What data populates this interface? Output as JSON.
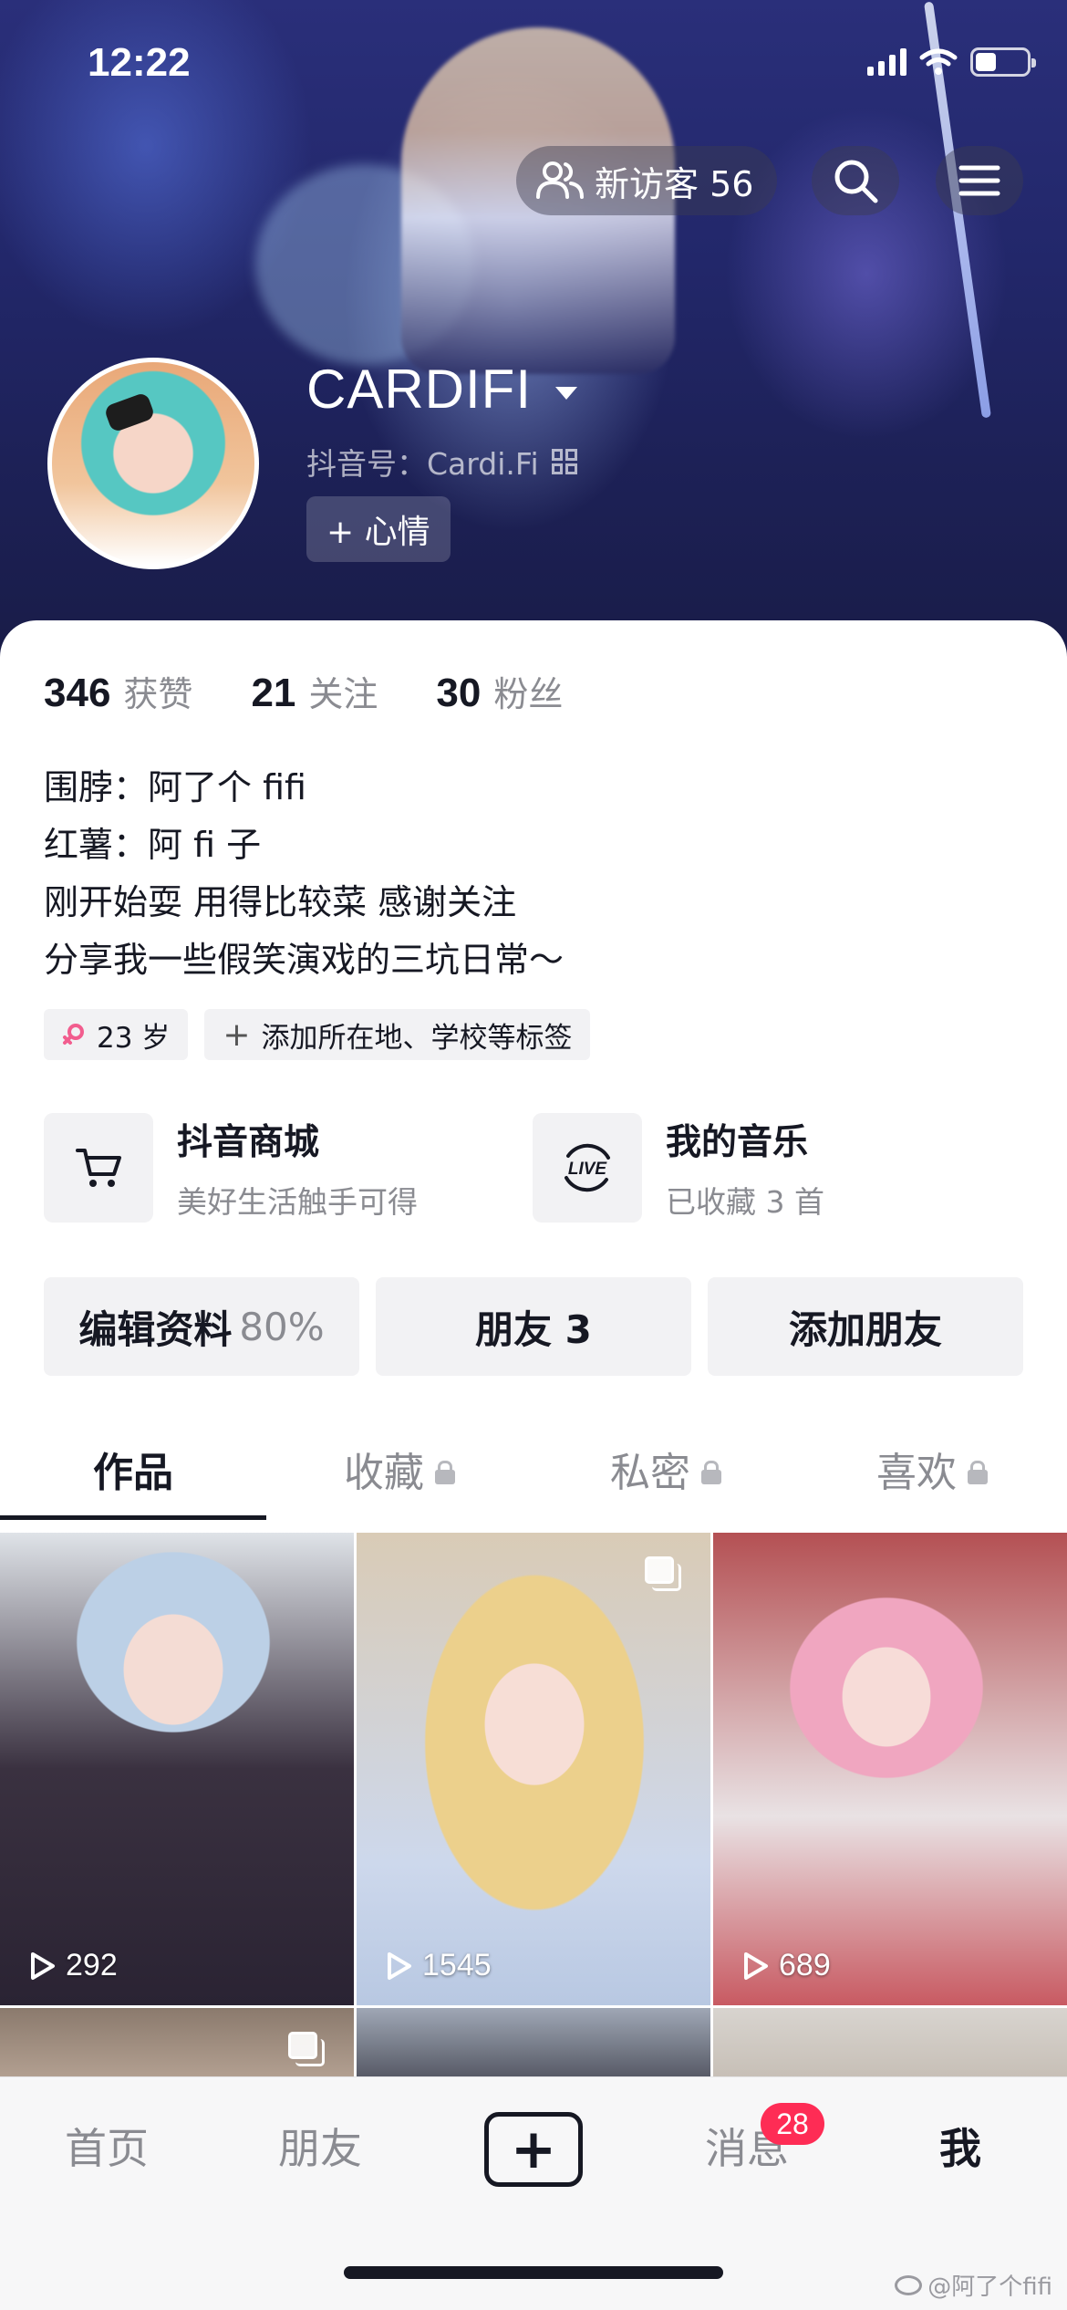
{
  "status_bar": {
    "time": "12:22"
  },
  "header": {
    "visitors_label": "新访客 56",
    "nickname": "CARDIFI",
    "douyin_id": "抖音号：Cardi.Fi",
    "mood_button": "+ 心情"
  },
  "stats": [
    {
      "value": "346",
      "label": "获赞"
    },
    {
      "value": "21",
      "label": "关注"
    },
    {
      "value": "30",
      "label": "粉丝"
    }
  ],
  "bio": [
    "围脖：阿了个 fifi",
    "红薯：阿 fi 子",
    "刚开始耍 用得比较菜 感谢关注",
    "分享我一些假笑演戏的三坑日常～"
  ],
  "tags": {
    "age": "23 岁",
    "add_tag": "添加所在地、学校等标签"
  },
  "features": [
    {
      "title": "抖音商城",
      "subtitle": "美好生活触手可得",
      "icon": "cart-icon"
    },
    {
      "title": "我的音乐",
      "subtitle": "已收藏 3 首",
      "icon": "live-music-icon"
    }
  ],
  "actions": {
    "edit_profile": "编辑资料",
    "edit_profile_progress": "80%",
    "friends": "朋友 3",
    "add_friend": "添加朋友"
  },
  "tabs": [
    {
      "label": "作品",
      "locked": false
    },
    {
      "label": "收藏",
      "locked": true
    },
    {
      "label": "私密",
      "locked": true
    },
    {
      "label": "喜欢",
      "locked": true
    }
  ],
  "videos": [
    {
      "plays": "292"
    },
    {
      "plays": "1545"
    },
    {
      "plays": "689"
    }
  ],
  "bottom_nav": {
    "home": "首页",
    "friends": "朋友",
    "post": "+",
    "messages": "消息",
    "messages_badge": "28",
    "me": "我"
  },
  "watermark": "@阿了个fifi",
  "colors": {
    "accent": "#fe2c55",
    "text": "#161823",
    "secondary": "#8a8b91"
  }
}
